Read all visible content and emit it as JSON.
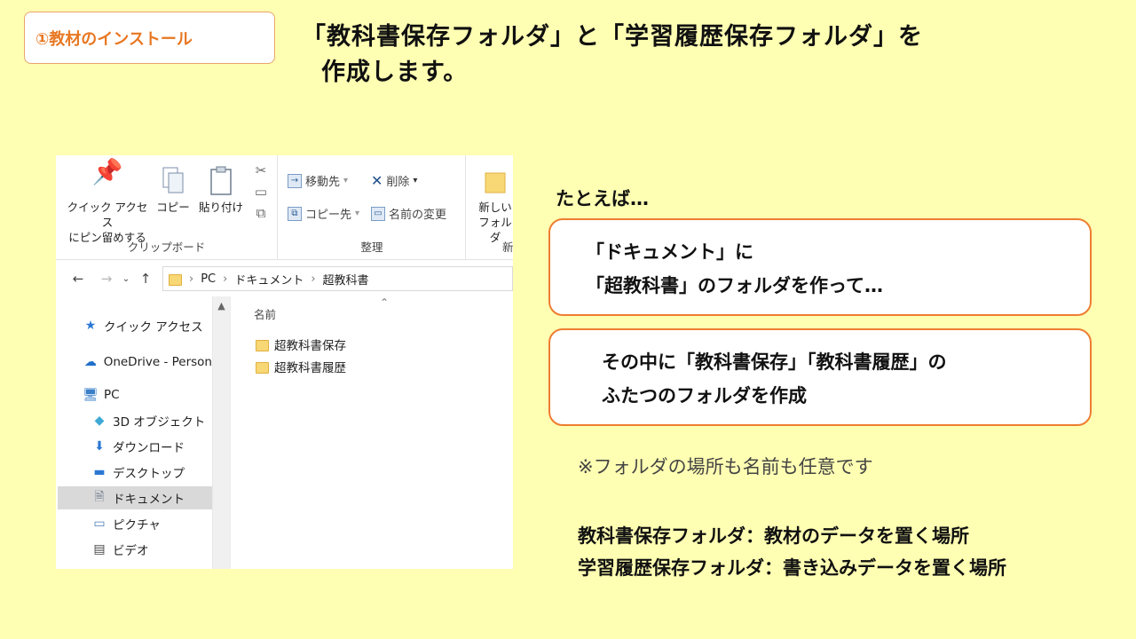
{
  "step_tag": "①教材のインストール",
  "headline": {
    "line1": "「教科書保存フォルダ」と「学習履歴保存フォルダ」を",
    "line2": "作成します。"
  },
  "explorer": {
    "ribbon": {
      "clipboard_group": "クリップボード",
      "organize_group": "整理",
      "new_group": "新",
      "pin_label_1": "クイック アクセス",
      "pin_label_2": "にピン留めする",
      "copy": "コピー",
      "paste": "貼り付け",
      "move_to": "移動先",
      "copy_to": "コピー先",
      "delete": "削除",
      "rename": "名前の変更",
      "new_folder_1": "新しい",
      "new_folder_2": "フォルダ"
    },
    "address": {
      "pc": "PC",
      "documents": "ドキュメント",
      "current": "超教科書"
    },
    "nav": [
      {
        "label": "クイック アクセス",
        "icon": "star-icon"
      },
      {
        "label": "OneDrive - Person",
        "icon": "cloud-icon"
      },
      {
        "label": "PC",
        "icon": "computer-icon"
      },
      {
        "label": "3D オブジェクト",
        "icon": "cube-icon"
      },
      {
        "label": "ダウンロード",
        "icon": "download-icon"
      },
      {
        "label": "デスクトップ",
        "icon": "desktop-icon"
      },
      {
        "label": "ドキュメント",
        "icon": "document-icon"
      },
      {
        "label": "ピクチャ",
        "icon": "picture-icon"
      },
      {
        "label": "ビデオ",
        "icon": "video-icon"
      }
    ],
    "column_header": "名前",
    "files": [
      "超教科書保存",
      "超教科書履歴"
    ]
  },
  "example_label": "たとえば…",
  "box1": {
    "line1": "「ドキュメント」に",
    "line2": "「超教科書」のフォルダを作って…"
  },
  "box2": {
    "line1": "その中に「教科書保存」「教科書履歴」の",
    "line2": "ふたつのフォルダを作成"
  },
  "note": "※フォルダの場所も名前も任意です",
  "definitions": {
    "line1": "教科書保存フォルダ：教材のデータを置く場所",
    "line2": "学習履歴保存フォルダ：書き込みデータを置く場所"
  }
}
